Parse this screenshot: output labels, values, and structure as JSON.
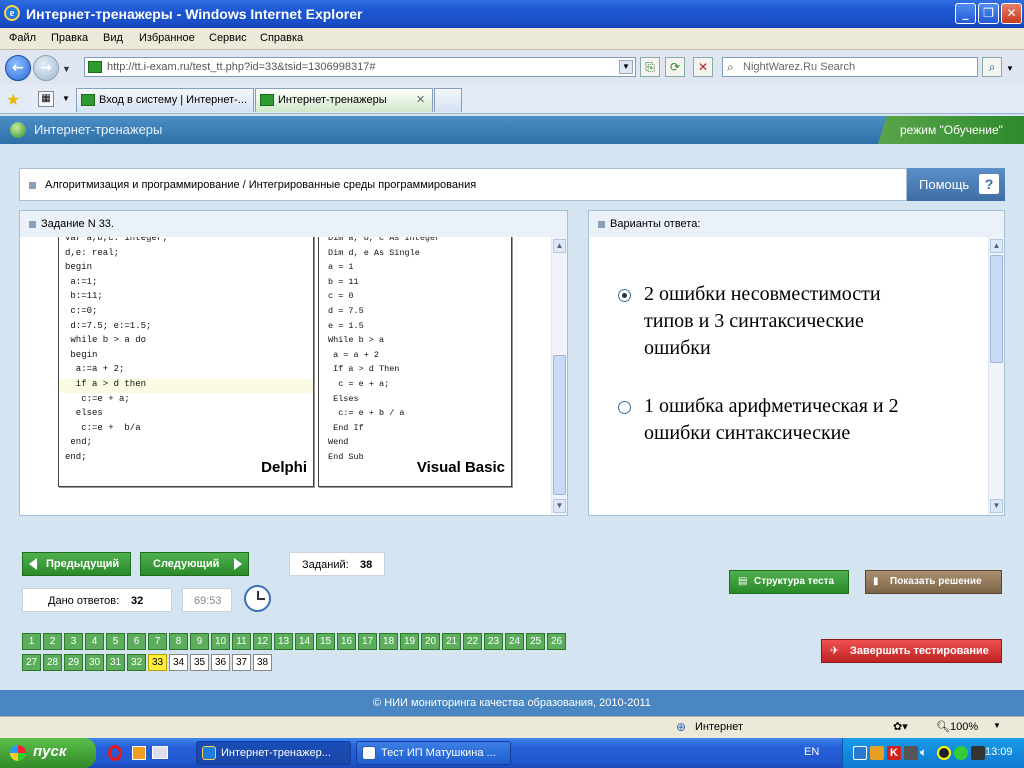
{
  "window": {
    "title": "Интернет-тренажеры - Windows Internet Explorer"
  },
  "menu": [
    "Файл",
    "Правка",
    "Вид",
    "Избранное",
    "Сервис",
    "Справка"
  ],
  "address": {
    "url": "http://tt.i-exam.ru/test_tt.php?id=33&tsid=1306998317#"
  },
  "search": {
    "placeholder": "NightWarez.Ru Search"
  },
  "tabs": [
    {
      "label": "Вход в систему | Интернет-..."
    },
    {
      "label": "Интернет-тренажеры"
    }
  ],
  "app": {
    "title": "Интернет-тренажеры",
    "mode": "режим \"Обучение\""
  },
  "topic": {
    "text": "Алгоритмизация и программирование / Интегрированные среды программирования",
    "help_label": "Помощь"
  },
  "task_panel": {
    "title": "Задание N 33.",
    "delphi_code": "var a,b,c: integer;\nd,e: real;\nbegin\n a:=1;\n b:=11;\n c:=0;\n d:=7.5; e:=1.5;\n while b > a do\n begin\n  a:=a + 2;\n  if a > d then\n   c:=e + a;\n  elses\n   c:=e +  b/a\n end;\nend;",
    "delphi_label": "Delphi",
    "vb_code": "Dim a, b, c As Integer\nDim d, e As Single\na = 1\nb = 11\nc = 0\nd = 7.5\ne = 1.5\nWhile b > a\n a = a + 2\n If a > d Then\n  c = e + a;\n Elses\n  c:= e + b / a\n End If\nWend\nEnd Sub",
    "vb_label": "Visual Basic"
  },
  "answers_panel": {
    "title": "Варианты ответа:",
    "options": [
      {
        "text": "2 ошибки несовместимости типов и 3 синтаксические ошибки",
        "selected": true
      },
      {
        "text": "1 ошибка арифметическая и 2 ошибки синтаксические",
        "selected": false
      }
    ]
  },
  "controls": {
    "prev_label": "Предыдущий",
    "next_label": "Следующий",
    "tasks_label": "Заданий:",
    "tasks_count": "38",
    "answered_label": "Дано ответов:",
    "answered_count": "32",
    "timer": "69:53",
    "structure_label": "Структура теста",
    "show_solution_label": "Показать решение",
    "finish_label": "Завершить тестирование"
  },
  "question_numbers": {
    "answered": [
      "1",
      "2",
      "3",
      "4",
      "5",
      "6",
      "7",
      "8",
      "9",
      "10",
      "11",
      "12",
      "13",
      "14",
      "15",
      "16",
      "17",
      "18",
      "19",
      "20",
      "21",
      "22",
      "23",
      "24",
      "25",
      "26",
      "27",
      "28",
      "29",
      "30",
      "31",
      "32"
    ],
    "current": "33",
    "unanswered": [
      "34",
      "35",
      "36",
      "37",
      "38"
    ]
  },
  "footer": {
    "text": "© НИИ мониторинга качества образования, 2010-2011"
  },
  "statusbar": {
    "zone": "Интернет",
    "zoom": "100%"
  },
  "taskbar": {
    "start_label": "пуск",
    "items": [
      {
        "label": "Интернет-тренажер..."
      },
      {
        "label": "Тест ИП Матушкина ..."
      }
    ],
    "lang": "EN",
    "clock": "13:09"
  },
  "colors": {
    "accent_green": "#2a8a2a",
    "current_question": "#ffef3a",
    "finish_red": "#d83030",
    "solution_brown": "#8a7050"
  }
}
